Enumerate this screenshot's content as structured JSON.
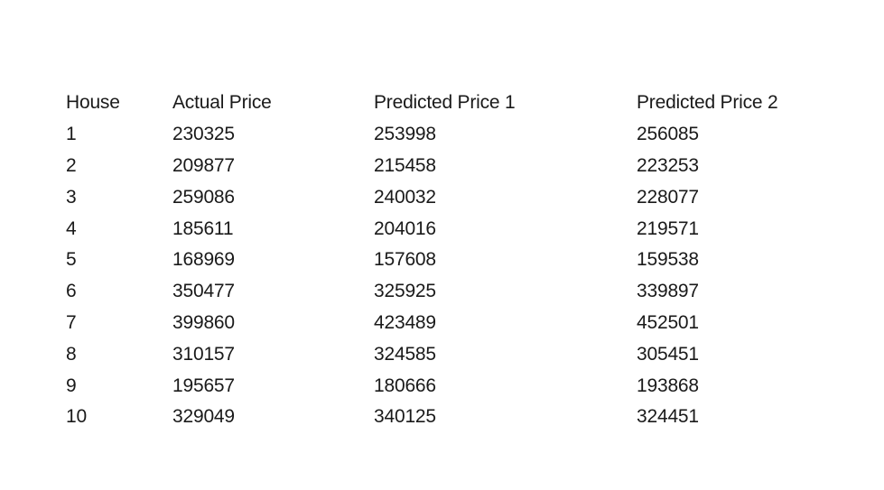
{
  "table": {
    "headers": [
      "House",
      "Actual Price",
      "Predicted Price 1",
      "Predicted Price 2"
    ],
    "rows": [
      [
        "1",
        "230325",
        "253998",
        "256085"
      ],
      [
        "2",
        "209877",
        "215458",
        "223253"
      ],
      [
        "3",
        "259086",
        "240032",
        "228077"
      ],
      [
        "4",
        "185611",
        "204016",
        "219571"
      ],
      [
        "5",
        "168969",
        "157608",
        "159538"
      ],
      [
        "6",
        "350477",
        "325925",
        "339897"
      ],
      [
        "7",
        "399860",
        "423489",
        "452501"
      ],
      [
        "8",
        "310157",
        "324585",
        "305451"
      ],
      [
        "9",
        "195657",
        "180666",
        "193868"
      ],
      [
        "10",
        "329049",
        "340125",
        "324451"
      ]
    ]
  }
}
